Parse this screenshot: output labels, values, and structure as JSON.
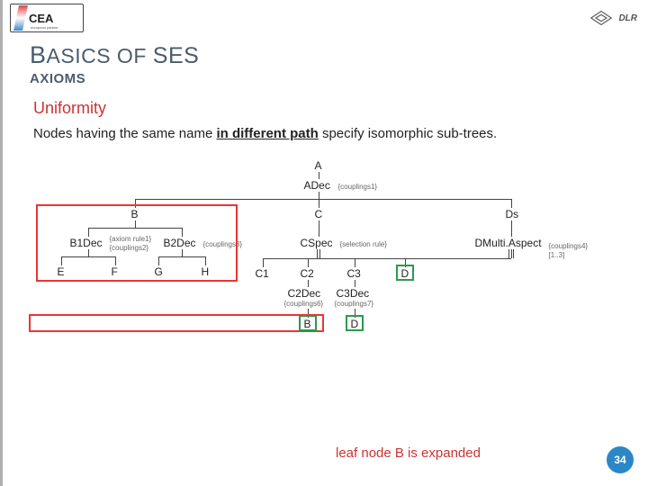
{
  "logos": {
    "cea": "CEA",
    "dlr": "DLR"
  },
  "title_prefix": "B",
  "title_mid": "ASICS OF ",
  "title_suffix": "SES",
  "subtitle": "AXIOMS",
  "section_title": "Uniformity",
  "body_pre": "Nodes having the same name ",
  "body_underline": "in different path",
  "body_post": " specify isomorphic sub-trees.",
  "nodes": {
    "A": "A",
    "ADec": "ADec",
    "B": "B",
    "C": "C",
    "Ds": "Ds",
    "B1Dec": "B1Dec",
    "B2Dec": "B2Dec",
    "E": "E",
    "F": "F",
    "G": "G",
    "H": "H",
    "CSpec": "CSpec",
    "C1": "C1",
    "C2": "C2",
    "C3": "C3",
    "D": "D",
    "C2Dec": "C2Dec",
    "C3Dec": "C3Dec",
    "B_leaf": "B",
    "D_leaf": "D",
    "DMultiAspect": "DMulti.Aspect"
  },
  "annotations": {
    "couplings1": "{couplings1}",
    "axiom_rule1": "{axiom rule1}",
    "couplings2": "{couplings2}",
    "couplings3": "{couplings3}",
    "selection_rule": "{selection rule}",
    "couplings4": "{couplings4}",
    "range": "[1..3]",
    "couplings6": "{couplings6}",
    "couplings7": "{couplings7}"
  },
  "caption": "leaf node B is expanded",
  "page_number": "34"
}
